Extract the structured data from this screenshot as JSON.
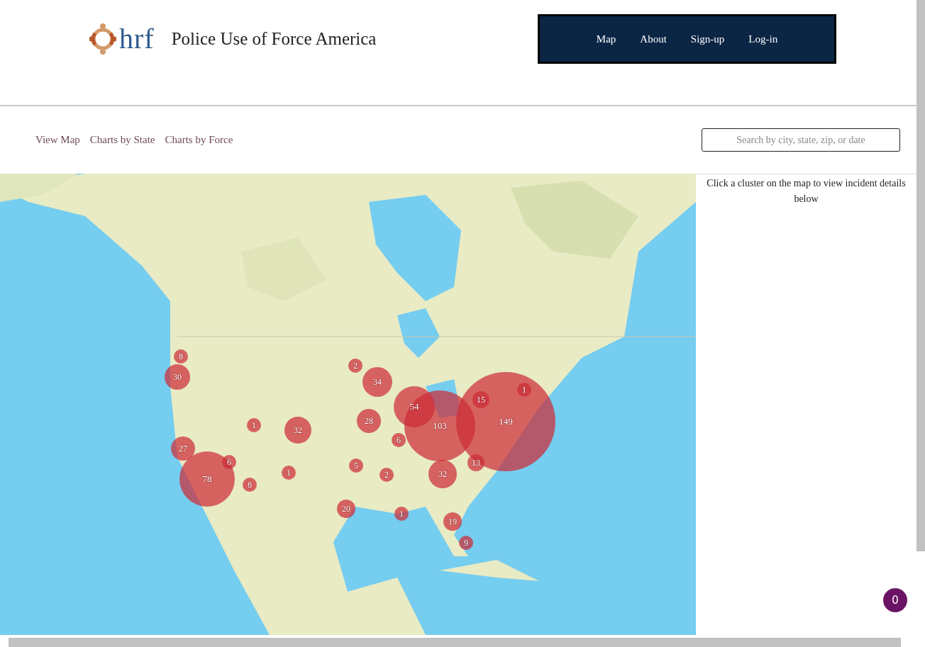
{
  "header": {
    "logo_text": "hrf",
    "title": "Police Use of Force America",
    "nav": [
      {
        "label": "Map"
      },
      {
        "label": "About"
      },
      {
        "label": "Sign-up"
      },
      {
        "label": "Log-in"
      }
    ]
  },
  "subnav": {
    "links": [
      {
        "label": "View Map"
      },
      {
        "label": "Charts by State"
      },
      {
        "label": "Charts by Force"
      }
    ],
    "search": {
      "placeholder": "Search by city, state, zip, or date"
    }
  },
  "map": {
    "kind": "picture",
    "clusters": [
      {
        "count": "8"
      },
      {
        "count": "30"
      },
      {
        "count": "2"
      },
      {
        "count": "34"
      },
      {
        "count": "1"
      },
      {
        "count": "15"
      },
      {
        "count": "54"
      },
      {
        "count": "28"
      },
      {
        "count": "149"
      },
      {
        "count": "1"
      },
      {
        "count": "103"
      },
      {
        "count": "32"
      },
      {
        "count": "6"
      },
      {
        "count": "27"
      },
      {
        "count": "6"
      },
      {
        "count": "13"
      },
      {
        "count": "5"
      },
      {
        "count": "1"
      },
      {
        "count": "2"
      },
      {
        "count": "32"
      },
      {
        "count": "78"
      },
      {
        "count": "8"
      },
      {
        "count": "20"
      },
      {
        "count": "1"
      },
      {
        "count": "19"
      },
      {
        "count": "9"
      }
    ]
  },
  "details": {
    "hint": "Click a cluster on the map to view incident details below"
  },
  "badge": {
    "count": "0"
  }
}
